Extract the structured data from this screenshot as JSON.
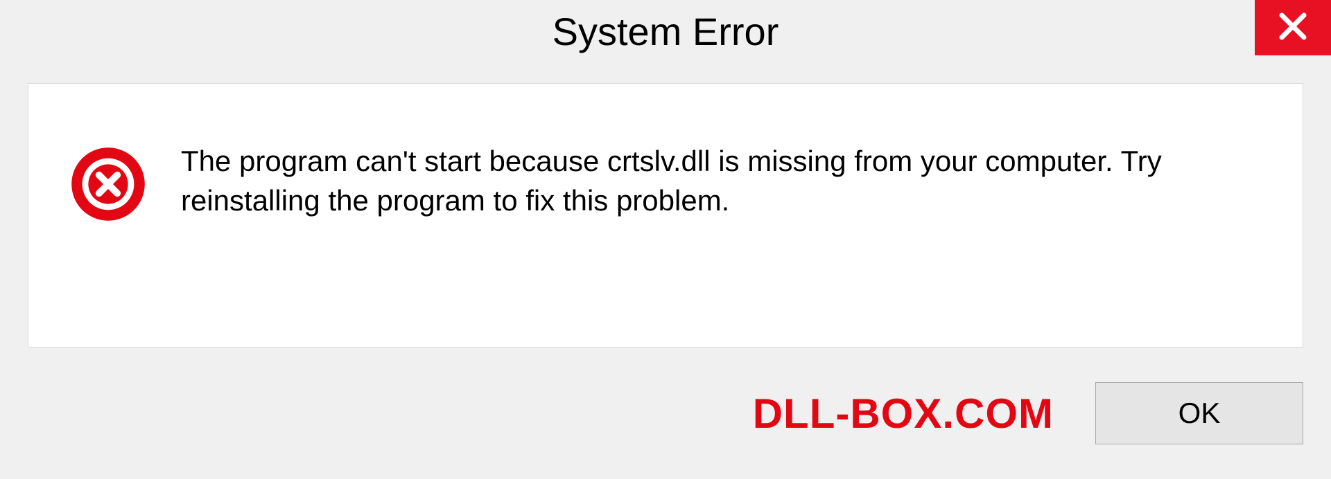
{
  "title": "System Error",
  "message": "The program can't start because crtslv.dll is missing from your computer. Try reinstalling the program to fix this problem.",
  "brand": "DLL-BOX.COM",
  "ok_label": "OK",
  "colors": {
    "close_bg": "#e81123",
    "error_icon": "#e30613",
    "brand_text": "#e30613"
  }
}
